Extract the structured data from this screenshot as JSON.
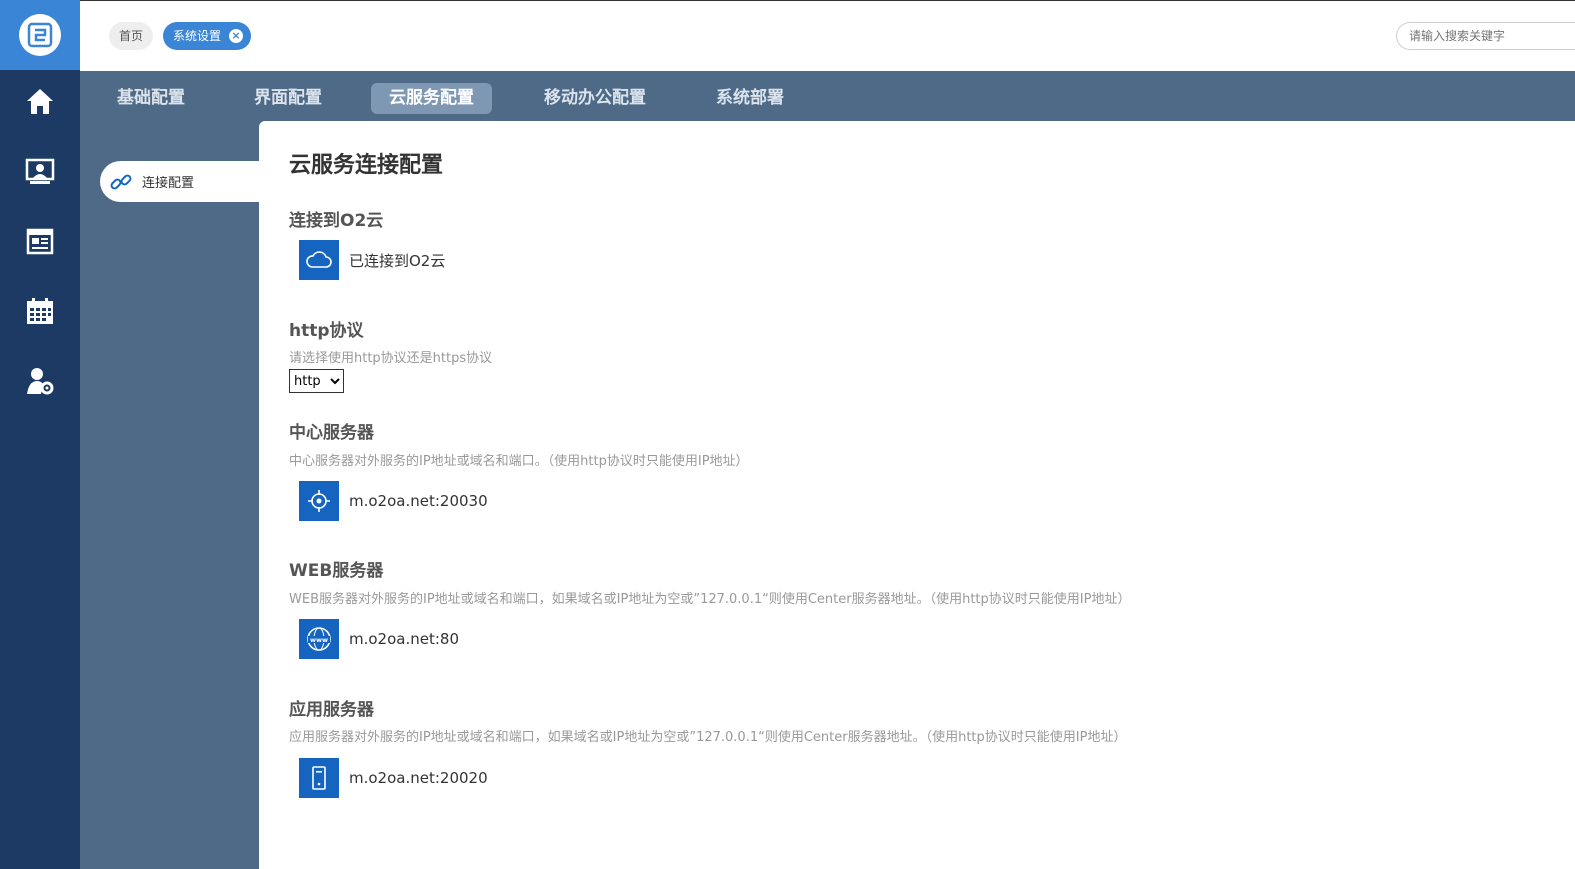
{
  "topbar": {
    "crumbs": [
      "首页",
      "系统设置"
    ],
    "search_placeholder": "请输入搜索关键字"
  },
  "rail": {
    "icons": [
      "logo-icon",
      "home-icon",
      "contact-card-icon",
      "news-icon",
      "calendar-icon",
      "user-settings-icon"
    ]
  },
  "tabs": [
    {
      "label": "基础配置",
      "active": false
    },
    {
      "label": "界面配置",
      "active": false
    },
    {
      "label": "云服务配置",
      "active": true
    },
    {
      "label": "移动办公配置",
      "active": false
    },
    {
      "label": "系统部署",
      "active": false
    }
  ],
  "sidemenu": {
    "items": [
      {
        "label": "连接配置",
        "icon": "link-icon",
        "active": true
      }
    ]
  },
  "content": {
    "page_title": "云服务连接配置",
    "connect": {
      "title": "连接到O2云",
      "status": "已连接到O2云",
      "icon": "cloud-icon"
    },
    "http": {
      "title": "http协议",
      "desc": "请选择使用http协议还是https协议",
      "selected": "http",
      "options": [
        "http"
      ]
    },
    "center": {
      "title": "中心服务器",
      "desc": "中心服务器对外服务的IP地址或域名和端口。（使用http协议时只能使用IP地址）",
      "value": "m.o2oa.net:20030",
      "icon": "crosshair-icon"
    },
    "web": {
      "title": "WEB服务器",
      "desc": "WEB服务器对外服务的IP地址或域名和端口，如果域名或IP地址为空或”127.0.0.1“则使用Center服务器地址。（使用http协议时只能使用IP地址）",
      "value": "m.o2oa.net:80",
      "icon": "www-icon"
    },
    "app": {
      "title": "应用服务器",
      "desc": "应用服务器对外服务的IP地址或域名和端口，如果域名或IP地址为空或”127.0.0.1“则使用Center服务器地址。（使用http协议时只能使用IP地址）",
      "value": "m.o2oa.net:20020",
      "icon": "server-icon"
    }
  },
  "colors": {
    "rail": "#1c3a63",
    "logo_bg": "#3a85d6",
    "tabbar": "#4e6a86",
    "active_tab": "#7e98b4",
    "icon_bg": "#1565c0"
  }
}
